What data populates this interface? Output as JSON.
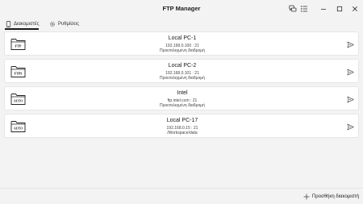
{
  "app": {
    "title": "FTP Manager"
  },
  "titlebar": {
    "icons": [
      "chat-icon",
      "list-icon",
      "minimize-icon",
      "maximize-icon",
      "close-icon"
    ]
  },
  "tabs": [
    {
      "label": "Διακομιστές",
      "icon": "phone-icon",
      "active": true
    },
    {
      "label": "Ρυθμίσεις",
      "icon": "gear-icon",
      "active": false
    }
  ],
  "servers": [
    {
      "name": "Local PC-1",
      "address": "192.168.0.100 : 21",
      "path": "Προεπιλεγμένη διαδρομή",
      "badge": "FTP"
    },
    {
      "name": "Local PC-2",
      "address": "192.168.0.101 : 21",
      "path": "Προεπιλεγμένη διαδρομή",
      "badge": "FTPS"
    },
    {
      "name": "Intel",
      "address": "ftp.intel.com : 21",
      "path": "Προεπιλεγμένη διαδρομή",
      "badge": "AUTO"
    },
    {
      "name": "Local PC-17",
      "address": "192.168.0.15 : 21",
      "path": "/Workspace/data",
      "badge": "AUTO"
    }
  ],
  "footer": {
    "add_label": "Προσθήκη διακομιστή"
  }
}
